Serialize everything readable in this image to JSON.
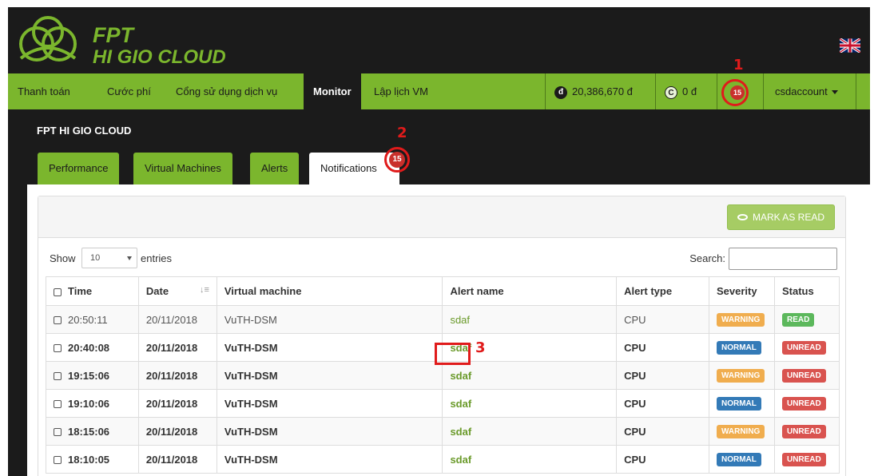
{
  "brand": {
    "line1": "FPT",
    "line2": "HI GIO CLOUD",
    "logo_color": "#7bb62d"
  },
  "navbar": {
    "items": [
      {
        "label": "Thanh toán"
      },
      {
        "label": "Cước phí"
      },
      {
        "label": "Cổng sử dụng dịch vụ"
      },
      {
        "label": "Monitor",
        "active": true
      },
      {
        "label": "Lập lịch VM"
      }
    ],
    "balance_icon": "đ",
    "balance": "20,386,670 đ",
    "credit_icon": "C",
    "credit": "0 đ",
    "notification_count": "15",
    "account": "csdaccount",
    "accent_color": "#7bb62d"
  },
  "annotations": {
    "n1": "1",
    "n2": "2",
    "n3": "3"
  },
  "page": {
    "title": "FPT HI GIO CLOUD",
    "tabs": [
      {
        "label": "Performance"
      },
      {
        "label": "Virtual Machines"
      },
      {
        "label": "Alerts"
      },
      {
        "label": "Notifications",
        "active": true,
        "badge": "15"
      }
    ]
  },
  "toolbar": {
    "mark_as_read": "MARK AS READ"
  },
  "table_controls": {
    "show_label": "Show",
    "page_size": "10",
    "entries_label": "entries",
    "search_label": "Search:"
  },
  "table": {
    "columns": [
      "Time",
      "Date",
      "Virtual machine",
      "Alert name",
      "Alert type",
      "Severity",
      "Status"
    ],
    "rows": [
      {
        "time": "20:50:11",
        "date": "20/11/2018",
        "vm": "VuTH-DSM",
        "alert": "sdaf",
        "type": "CPU",
        "severity": "WARNING",
        "status": "READ"
      },
      {
        "time": "20:40:08",
        "date": "20/11/2018",
        "vm": "VuTH-DSM",
        "alert": "sdaf",
        "type": "CPU",
        "severity": "NORMAL",
        "status": "UNREAD"
      },
      {
        "time": "19:15:06",
        "date": "20/11/2018",
        "vm": "VuTH-DSM",
        "alert": "sdaf",
        "type": "CPU",
        "severity": "WARNING",
        "status": "UNREAD"
      },
      {
        "time": "19:10:06",
        "date": "20/11/2018",
        "vm": "VuTH-DSM",
        "alert": "sdaf",
        "type": "CPU",
        "severity": "NORMAL",
        "status": "UNREAD"
      },
      {
        "time": "18:15:06",
        "date": "20/11/2018",
        "vm": "VuTH-DSM",
        "alert": "sdaf",
        "type": "CPU",
        "severity": "WARNING",
        "status": "UNREAD"
      },
      {
        "time": "18:10:05",
        "date": "20/11/2018",
        "vm": "VuTH-DSM",
        "alert": "sdaf",
        "type": "CPU",
        "severity": "NORMAL",
        "status": "UNREAD"
      }
    ],
    "label_colors": {
      "WARNING": "#f0ad4e",
      "NORMAL": "#337ab7",
      "READ": "#5cb85c",
      "UNREAD": "#d9534f"
    }
  }
}
